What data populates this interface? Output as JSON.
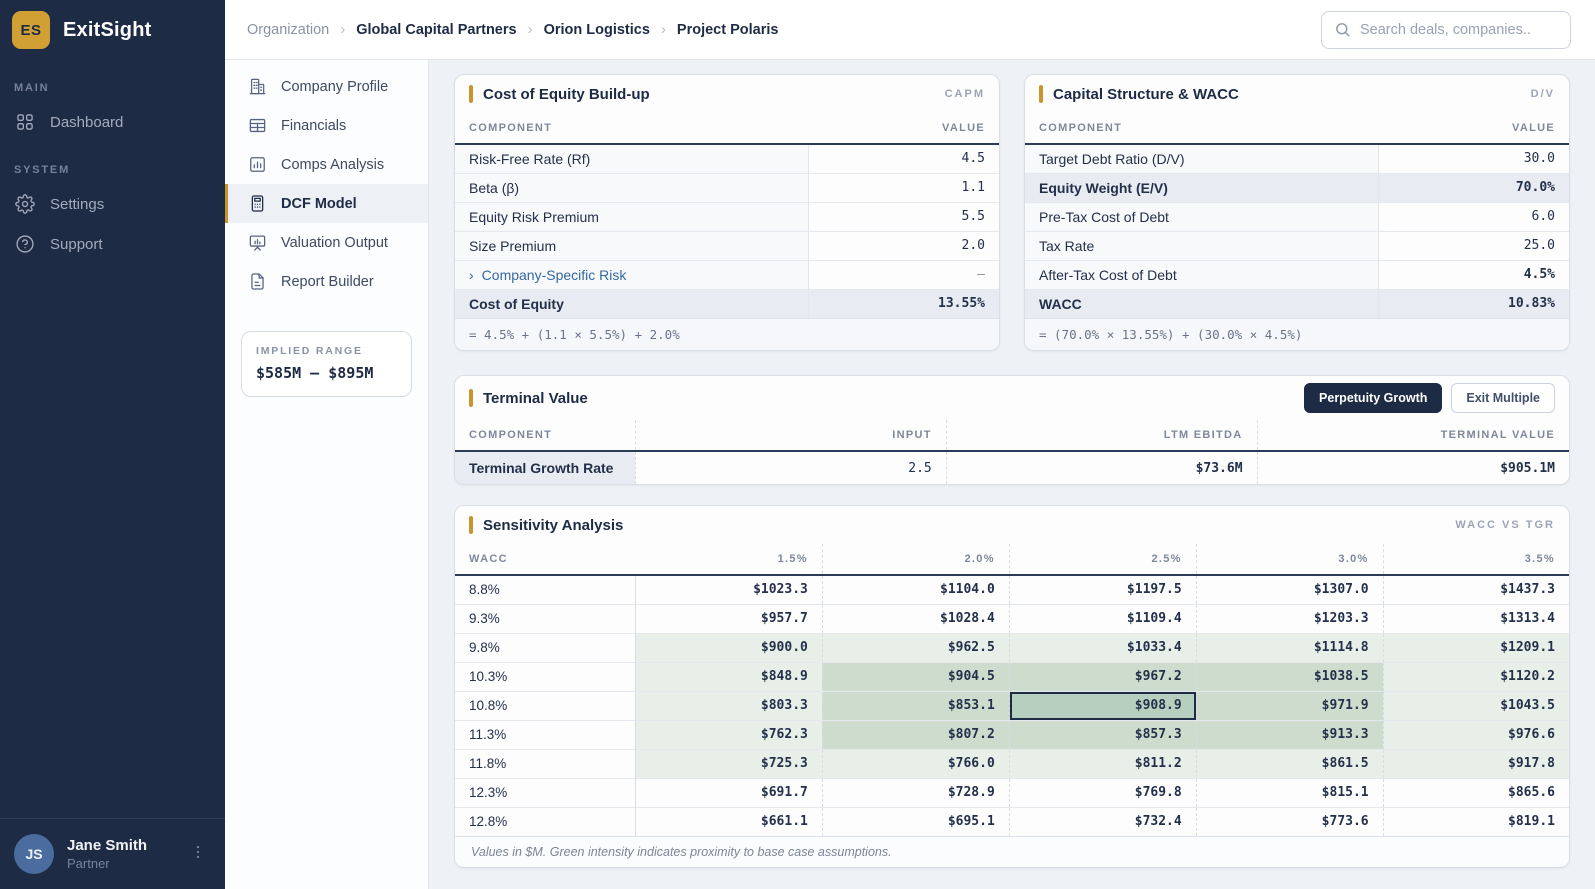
{
  "app": {
    "name": "ExitSight",
    "logo_initials": "ES"
  },
  "colors": {
    "accent_gold": "#C9962E",
    "navy": "#1D2B45",
    "green_level_1": "#E8EFE8",
    "green_level_2": "#CDDCCD",
    "green_level_3": "#B7CFBF"
  },
  "topbar": {
    "breadcrumb": [
      "Organization",
      "Global Capital Partners",
      "Orion Logistics",
      "Project Polaris"
    ],
    "search_placeholder": "Search deals, companies.."
  },
  "sidebar": {
    "sections": [
      {
        "label": "MAIN",
        "items": [
          {
            "label": "Dashboard",
            "icon": "dashboard-icon"
          }
        ]
      },
      {
        "label": "SYSTEM",
        "items": [
          {
            "label": "Settings",
            "icon": "gear-icon"
          },
          {
            "label": "Support",
            "icon": "help-icon"
          }
        ]
      }
    ],
    "user": {
      "initials": "JS",
      "name": "Jane Smith",
      "role": "Partner"
    }
  },
  "subsidebar": {
    "items": [
      {
        "label": "Company Profile",
        "icon": "building-icon",
        "active": false
      },
      {
        "label": "Financials",
        "icon": "table-icon",
        "active": false
      },
      {
        "label": "Comps Analysis",
        "icon": "bar-chart-icon",
        "active": false
      },
      {
        "label": "DCF Model",
        "icon": "calculator-icon",
        "active": true
      },
      {
        "label": "Valuation Output",
        "icon": "presentation-icon",
        "active": false
      },
      {
        "label": "Report Builder",
        "icon": "document-icon",
        "active": false
      }
    ],
    "implied_range": {
      "label": "IMPLIED RANGE",
      "value": "$585M — $895M"
    }
  },
  "cost_of_equity": {
    "title": "Cost of Equity Build-up",
    "tag": "CAPM",
    "columns": [
      "COMPONENT",
      "VALUE"
    ],
    "rows": [
      {
        "label": "Risk-Free Rate (Rf)",
        "value": "4.5",
        "editable": true
      },
      {
        "label": "Beta (β)",
        "value": "1.1",
        "editable": true
      },
      {
        "label": "Equity Risk Premium",
        "value": "5.5",
        "editable": true
      },
      {
        "label": "Size Premium",
        "value": "2.0",
        "editable": true
      },
      {
        "label": "Company-Specific Risk",
        "value": "—",
        "link": true,
        "editable": true
      },
      {
        "label": "Cost of Equity",
        "value": "13.55%",
        "emphasis": true
      }
    ],
    "formula": "= 4.5% + (1.1 × 5.5%) + 2.0%"
  },
  "capital_structure": {
    "title": "Capital Structure & WACC",
    "tag": "D/V",
    "columns": [
      "COMPONENT",
      "VALUE"
    ],
    "rows": [
      {
        "label": "Target Debt Ratio (D/V)",
        "value": "30.0",
        "editable": true
      },
      {
        "label": "Equity Weight (E/V)",
        "value": "70.0%",
        "emphasis": true
      },
      {
        "label": "Pre-Tax Cost of Debt",
        "value": "6.0",
        "editable": true
      },
      {
        "label": "Tax Rate",
        "value": "25.0",
        "editable": true
      },
      {
        "label": "After-Tax Cost of Debt",
        "value": "4.5%",
        "bold_value": true
      },
      {
        "label": "WACC",
        "value": "10.83%",
        "emphasis": true
      }
    ],
    "formula": "= (70.0% × 13.55%) + (30.0% × 4.5%)"
  },
  "terminal_value": {
    "title": "Terminal Value",
    "buttons": [
      {
        "label": "Perpetuity Growth",
        "active": true
      },
      {
        "label": "Exit Multiple",
        "active": false
      }
    ],
    "columns": [
      "COMPONENT",
      "INPUT",
      "LTM EBITDA",
      "TERMINAL VALUE"
    ],
    "row": {
      "label": "Terminal Growth Rate",
      "input": "2.5",
      "ltm_ebitda": "$73.6M",
      "terminal_value": "$905.1M"
    }
  },
  "sensitivity": {
    "title": "Sensitivity Analysis",
    "tag": "WACC VS TGR",
    "corner_label": "WACC",
    "col_headers": [
      "1.5%",
      "2.0%",
      "2.5%",
      "3.0%",
      "3.5%"
    ],
    "row_headers": [
      "8.8%",
      "9.3%",
      "9.8%",
      "10.3%",
      "10.8%",
      "11.3%",
      "11.8%",
      "12.3%",
      "12.8%"
    ],
    "values": [
      [
        "$1023.3",
        "$1104.0",
        "$1197.5",
        "$1307.0",
        "$1437.3"
      ],
      [
        "$957.7",
        "$1028.4",
        "$1109.4",
        "$1203.3",
        "$1313.4"
      ],
      [
        "$900.0",
        "$962.5",
        "$1033.4",
        "$1114.8",
        "$1209.1"
      ],
      [
        "$848.9",
        "$904.5",
        "$967.2",
        "$1038.5",
        "$1120.2"
      ],
      [
        "$803.3",
        "$853.1",
        "$908.9",
        "$971.9",
        "$1043.5"
      ],
      [
        "$762.3",
        "$807.2",
        "$857.3",
        "$913.3",
        "$976.6"
      ],
      [
        "$725.3",
        "$766.0",
        "$811.2",
        "$861.5",
        "$917.8"
      ],
      [
        "$691.7",
        "$728.9",
        "$769.8",
        "$815.1",
        "$865.6"
      ],
      [
        "$661.1",
        "$695.1",
        "$732.4",
        "$773.6",
        "$819.1"
      ]
    ],
    "green_levels": [
      [
        0,
        0,
        0,
        0,
        0
      ],
      [
        0,
        0,
        0,
        0,
        0
      ],
      [
        1,
        1,
        1,
        1,
        1
      ],
      [
        1,
        2,
        2,
        2,
        1
      ],
      [
        1,
        2,
        3,
        2,
        1
      ],
      [
        1,
        2,
        2,
        2,
        1
      ],
      [
        1,
        1,
        1,
        1,
        1
      ],
      [
        0,
        0,
        0,
        0,
        0
      ],
      [
        0,
        0,
        0,
        0,
        0
      ]
    ],
    "selected": {
      "row": 4,
      "col": 2
    },
    "footnote": "Values in $M. Green intensity indicates proximity to base case assumptions."
  }
}
